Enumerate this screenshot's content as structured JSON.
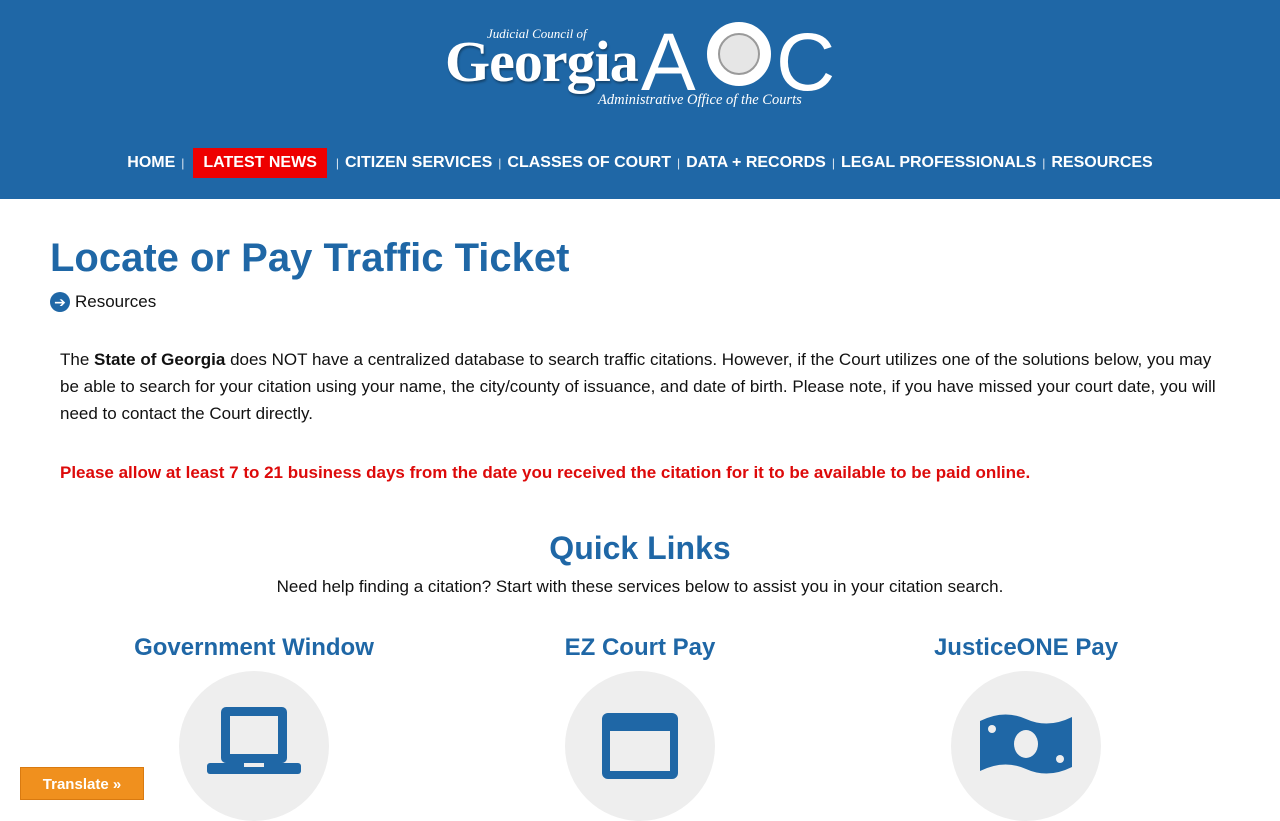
{
  "header": {
    "logo": {
      "top_text": "Judicial Council of",
      "georgia": "Georgia",
      "aoc_a": "A",
      "aoc_c": "C",
      "subtitle": "Administrative Office of the Courts"
    },
    "nav": [
      {
        "label": "HOME"
      },
      {
        "label": "LATEST NEWS",
        "active": true
      },
      {
        "label": "CITIZEN SERVICES"
      },
      {
        "label": "CLASSES OF COURT"
      },
      {
        "label": "DATA + RECORDS"
      },
      {
        "label": "LEGAL PROFESSIONALS"
      },
      {
        "label": "RESOURCES"
      }
    ],
    "nav_separator": "|"
  },
  "page": {
    "title": "Locate or Pay Traffic Ticket",
    "breadcrumb": {
      "icon": "arrow-right-circle-icon",
      "label": "Resources"
    },
    "intro": {
      "before_bold": "The ",
      "bold": "State of Georgia",
      "after_bold": " does NOT have a centralized database to search traffic citations. However, if the Court utilizes one of the solutions below, you may be able to search for your citation using your name, the city/county of issuance, and date of birth. Please note, if you have missed your court date, you will need to contact the Court directly."
    },
    "warning": "Please allow at least 7 to 21 business days from the date you received the citation for it to be available to be paid online."
  },
  "quick_links": {
    "title": "Quick Links",
    "subtitle": "Need help finding a citation? Start with these services below to assist you in your citation search.",
    "cards": [
      {
        "title": "Government Window",
        "icon": "laptop-icon"
      },
      {
        "title": "EZ Court Pay",
        "icon": "browser-window-icon"
      },
      {
        "title": "JusticeONE Pay",
        "icon": "money-bill-icon"
      }
    ]
  },
  "translate": {
    "label": "Translate »"
  },
  "colors": {
    "header_bg": "#1f67a6",
    "accent_blue": "#1f67a6",
    "active_nav_bg": "#ee0000",
    "warning_red": "#dd0a0a",
    "translate_bg": "#f0901e",
    "icon_circle_bg": "#eeeeee"
  }
}
